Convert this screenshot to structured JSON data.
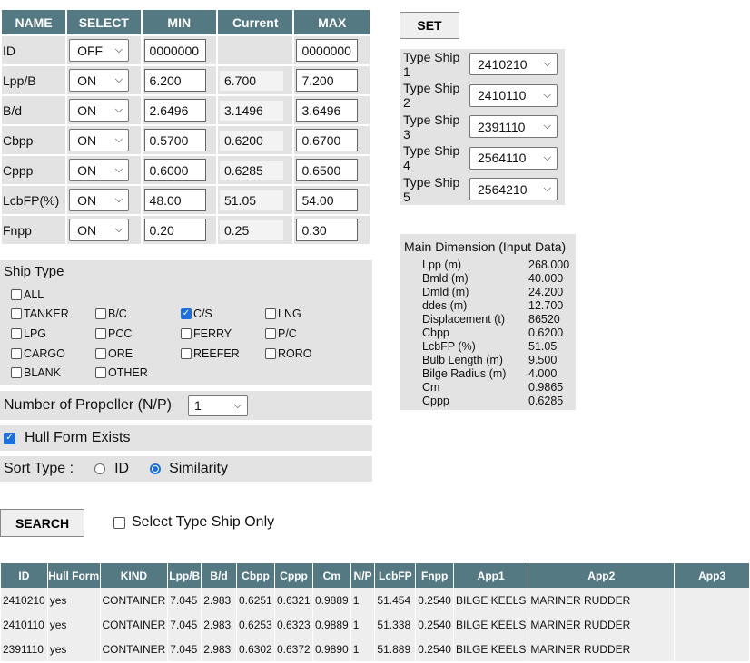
{
  "param_table": {
    "headers": [
      "NAME",
      "SELECT",
      "MIN",
      "Current",
      "MAX"
    ],
    "rows": [
      {
        "name": "ID",
        "select": "OFF",
        "min": "0000000",
        "current": "",
        "max": "0000000"
      },
      {
        "name": "Lpp/B",
        "select": "ON",
        "min": "6.200",
        "current": "6.700",
        "max": "7.200"
      },
      {
        "name": "B/d",
        "select": "ON",
        "min": "2.6496",
        "current": "3.1496",
        "max": "3.6496"
      },
      {
        "name": "Cbpp",
        "select": "ON",
        "min": "0.5700",
        "current": "0.6200",
        "max": "0.6700"
      },
      {
        "name": "Cppp",
        "select": "ON",
        "min": "0.6000",
        "current": "0.6285",
        "max": "0.6500"
      },
      {
        "name": "LcbFP(%)",
        "select": "ON",
        "min": "48.00",
        "current": "51.05",
        "max": "54.00"
      },
      {
        "name": "Fnpp",
        "select": "ON",
        "min": "0.20",
        "current": "0.25",
        "max": "0.30"
      }
    ]
  },
  "ship_type": {
    "title": "Ship Type",
    "options": [
      {
        "label": "ALL",
        "checked": false
      },
      {
        "label": "TANKER",
        "checked": false
      },
      {
        "label": "B/C",
        "checked": false
      },
      {
        "label": "C/S",
        "checked": true
      },
      {
        "label": "LNG",
        "checked": false
      },
      {
        "label": "LPG",
        "checked": false
      },
      {
        "label": "PCC",
        "checked": false
      },
      {
        "label": "FERRY",
        "checked": false
      },
      {
        "label": "P/C",
        "checked": false
      },
      {
        "label": "CARGO",
        "checked": false
      },
      {
        "label": "ORE",
        "checked": false
      },
      {
        "label": "REEFER",
        "checked": false
      },
      {
        "label": "RORO",
        "checked": false
      },
      {
        "label": "BLANK",
        "checked": false
      },
      {
        "label": "OTHER",
        "checked": false
      }
    ]
  },
  "propeller": {
    "label": "Number of Propeller (N/P)",
    "value": "1"
  },
  "hull_form": {
    "label": "Hull Form Exists",
    "checked": true
  },
  "sort": {
    "label": "Sort Type :",
    "options": [
      "ID",
      "Similarity"
    ],
    "selected": "Similarity"
  },
  "buttons": {
    "set": "SET",
    "search": "SEARCH"
  },
  "select_type_only": {
    "label": "Select Type Ship Only",
    "checked": false
  },
  "type_ships": [
    {
      "label": "Type Ship 1",
      "value": "2410210"
    },
    {
      "label": "Type Ship 2",
      "value": "2410110"
    },
    {
      "label": "Type Ship 3",
      "value": "2391110"
    },
    {
      "label": "Type Ship 4",
      "value": "2564110"
    },
    {
      "label": "Type Ship 5",
      "value": "2564210"
    }
  ],
  "main_dimension": {
    "title": "Main Dimension (Input Data)",
    "rows": [
      {
        "label": "Lpp (m)",
        "value": "268.000"
      },
      {
        "label": "Bmld (m)",
        "value": "40.000"
      },
      {
        "label": "Dmld (m)",
        "value": "24.200"
      },
      {
        "label": "ddes (m)",
        "value": "12.700"
      },
      {
        "label": "Displacement (t)",
        "value": "86520"
      },
      {
        "label": "Cbpp",
        "value": "0.6200"
      },
      {
        "label": "LcbFP (%)",
        "value": "51.05"
      },
      {
        "label": "Bulb Length (m)",
        "value": "9.500"
      },
      {
        "label": "Bilge Radius (m)",
        "value": "4.000"
      },
      {
        "label": "Cm",
        "value": "0.9865"
      },
      {
        "label": "Cppp",
        "value": "0.6285"
      }
    ]
  },
  "results": {
    "headers": [
      "ID",
      "Hull Form",
      "KIND",
      "Lpp/B",
      "B/d",
      "Cbpp",
      "Cppp",
      "Cm",
      "N/P",
      "LcbFP",
      "Fnpp",
      "App1",
      "App2",
      "App3"
    ],
    "rows": [
      [
        "2410210",
        "yes",
        "CONTAINER",
        "7.045",
        "2.983",
        "0.6251",
        "0.6321",
        "0.9889",
        "1",
        "51.454",
        "0.2540",
        "BILGE KEELS",
        "MARINER RUDDER",
        ""
      ],
      [
        "2410110",
        "yes",
        "CONTAINER",
        "7.045",
        "2.983",
        "0.6253",
        "0.6323",
        "0.9889",
        "1",
        "51.338",
        "0.2540",
        "BILGE KEELS",
        "MARINER RUDDER",
        ""
      ],
      [
        "2391110",
        "yes",
        "CONTAINER",
        "7.045",
        "2.983",
        "0.6302",
        "0.6372",
        "0.9890",
        "1",
        "51.889",
        "0.2540",
        "BILGE KEELS",
        "MARINER RUDDER",
        ""
      ]
    ]
  }
}
